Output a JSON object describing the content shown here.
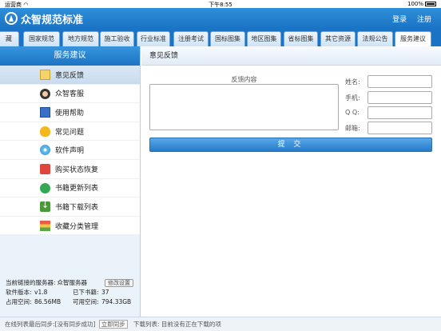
{
  "statusbar": {
    "carrier": "运营商",
    "wifi_icon": "wifi-icon",
    "time": "下午8:55",
    "battery": "100%"
  },
  "header": {
    "logo_text": "众智规范标准",
    "login": "登录",
    "register": "注册"
  },
  "tabs": [
    "藏",
    "国家规范",
    "地方规范",
    "施工验收",
    "行业标准",
    "注册考试",
    "国标图集",
    "地区图集",
    "省标图集",
    "其它资源",
    "法规公告",
    "服务建议"
  ],
  "active_tab": "服务建议",
  "sidebar": {
    "title": "服务建议",
    "items": [
      {
        "label": "意见反馈",
        "icon": "note-icon"
      },
      {
        "label": "众智客服",
        "icon": "headset-icon"
      },
      {
        "label": "使用帮助",
        "icon": "book-icon"
      },
      {
        "label": "常见问题",
        "icon": "bulb-icon"
      },
      {
        "label": "软件声明",
        "icon": "cd-icon"
      },
      {
        "label": "购买状态恢复",
        "icon": "cart-icon"
      },
      {
        "label": "书籍更新列表",
        "icon": "refresh-icon"
      },
      {
        "label": "书籍下载列表",
        "icon": "download-icon"
      },
      {
        "label": "收藏分类管理",
        "icon": "category-icon"
      }
    ],
    "info": {
      "server_label": "当前链接的服务器:",
      "server_value": "众智服务器",
      "modify_button": "修改设置",
      "version_label": "软件版本:",
      "version_value": "v1.8",
      "downloaded_label": "已下书籍:",
      "downloaded_value": "37",
      "used_label": "占用空间:",
      "used_value": "86.56MB",
      "free_label": "可用空间:",
      "free_value": "794.33GB"
    }
  },
  "content": {
    "title": "意见反馈",
    "feedback_label": "反馈内容",
    "fields": {
      "name": "姓名:",
      "phone": "手机:",
      "qq": "Q Q:",
      "email": "邮箱:"
    },
    "submit": "提 交"
  },
  "footer": {
    "sync_text": "在线列表最后同步:",
    "sync_status": "[没有同步成功]",
    "sync_button": "立即同步",
    "download_text": "下载列表: 目前没有正在下载的项"
  }
}
